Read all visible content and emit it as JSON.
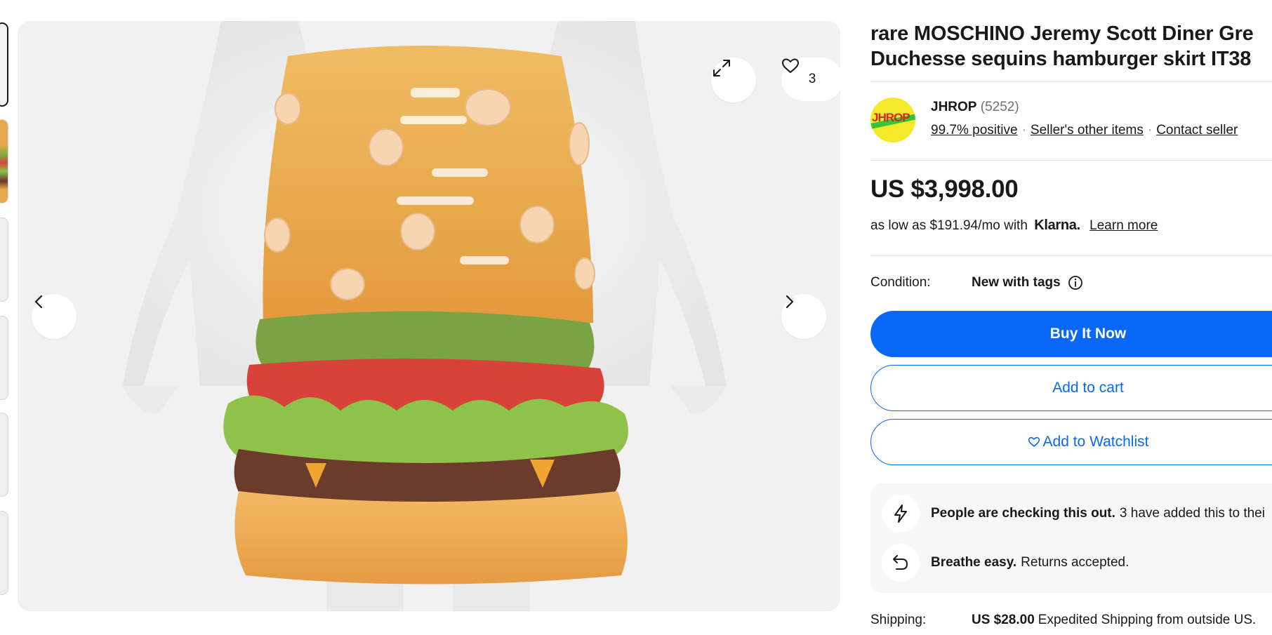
{
  "gallery": {
    "watch_count": "3",
    "icons": {
      "expand": "expand-icon",
      "heart": "heart-icon",
      "prev": "chevron-left-icon",
      "next": "chevron-right-icon"
    }
  },
  "listing": {
    "title_line1": "rare MOSCHINO Jeremy Scott Diner Gre",
    "title_line2": "Duchesse sequins hamburger skirt IT38"
  },
  "seller": {
    "logo_text": "JHROP",
    "name": "JHROP",
    "feedback_count": "(5252)",
    "positive": "99.7% positive",
    "other_items": "Seller's other items",
    "contact": "Contact seller"
  },
  "price": {
    "amount": "US $3,998.00",
    "financing_prefix": "as low as $191.94/mo with",
    "financing_brand": "Klarna.",
    "learn_more": "Learn more"
  },
  "condition": {
    "label": "Condition:",
    "value": "New with tags"
  },
  "actions": {
    "buy_now": "Buy It Now",
    "add_to_cart": "Add to cart",
    "add_to_watchlist": "Add to Watchlist"
  },
  "signals": [
    {
      "bold": "People are checking this out.",
      "text": "3 have added this to thei",
      "icon": "lightning-icon"
    },
    {
      "bold": "Breathe easy.",
      "text": "Returns accepted.",
      "icon": "return-arrow-icon"
    }
  ],
  "shipping": {
    "label": "Shipping:",
    "price": "US $28.00",
    "method": "Expedited Shipping from outside US."
  },
  "colors": {
    "primary": "#0968f6",
    "text": "#191919",
    "muted": "#707070",
    "seller_logo_bg": "#f4ea2b"
  }
}
